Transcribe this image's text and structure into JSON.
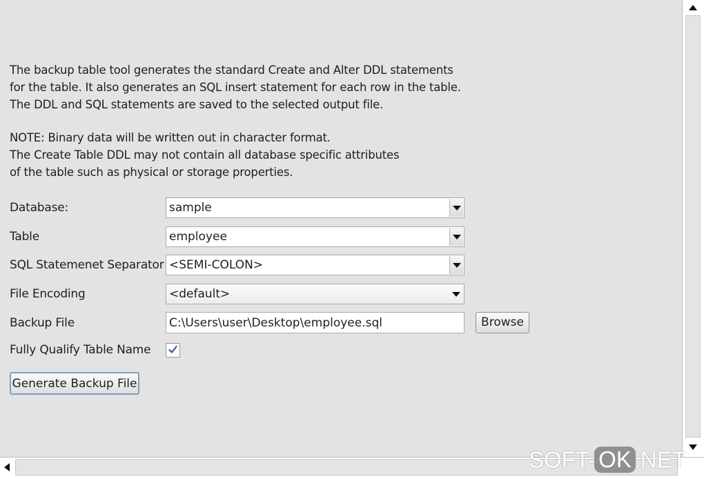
{
  "description": {
    "paragraph1": [
      "The backup table tool generates the standard Create and Alter DDL statements",
      "for the table. It also generates an SQL insert statement for each row in the table.",
      "The DDL and SQL statements are saved to the selected output file."
    ],
    "paragraph2": [
      "NOTE: Binary data will be written out in character format.",
      "The Create Table DDL may not contain all database specific attributes",
      "of the table such as physical or storage properties."
    ]
  },
  "form": {
    "database": {
      "label": "Database:",
      "value": "sample"
    },
    "table": {
      "label": "Table",
      "value": "employee"
    },
    "separator": {
      "label": "SQL Statemenet Separator",
      "value": "<SEMI-COLON>"
    },
    "encoding": {
      "label": "File Encoding",
      "value": "<default>"
    },
    "backup_file": {
      "label": "Backup File",
      "value": "C:\\Users\\user\\Desktop\\employee.sql",
      "browse_label": "Browse"
    },
    "qualify": {
      "label": "Fully Qualify Table Name",
      "checked": true
    },
    "generate_label": "Generate Backup File"
  },
  "icons": {
    "combo_arrow": "chevron-down-icon",
    "checkbox_tick": "checkmark-icon",
    "scroll_up": "arrow-up-icon",
    "scroll_down": "arrow-down-icon",
    "scroll_left": "arrow-left-icon"
  },
  "watermark": {
    "left": "SOFT-",
    "middle": "OK",
    "right": ".NET"
  },
  "colors": {
    "panel_bg": "#e3e3e3",
    "field_bg": "#ffffff",
    "checkbox_tick": "#3b5b8a",
    "default_button_border": "#7aa0c8"
  }
}
